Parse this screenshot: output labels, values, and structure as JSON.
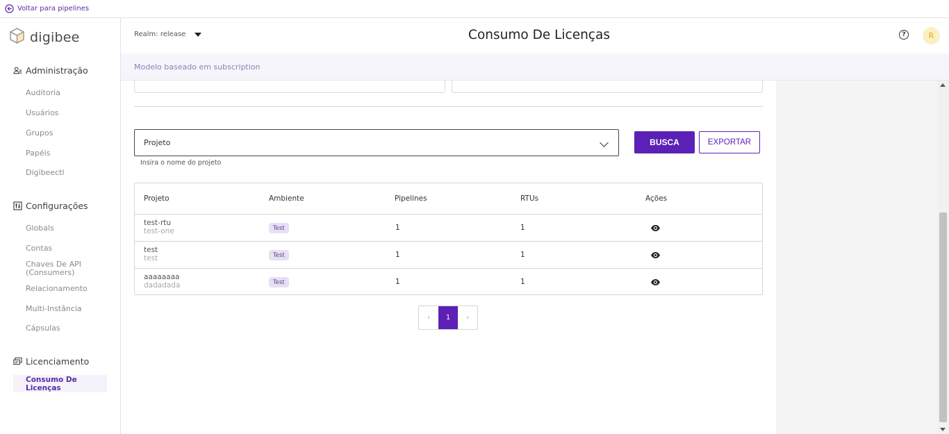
{
  "topbar": {
    "back_label": "Voltar para pipelines"
  },
  "brand": {
    "name": "digibee",
    "accent": "#5b21b6"
  },
  "sidebar": {
    "sections": [
      {
        "title": "Administração",
        "icon": "users-icon",
        "items": [
          "Auditoria",
          "Usuários",
          "Grupos",
          "Papéis",
          "Digibeectl"
        ]
      },
      {
        "title": "Configurações",
        "icon": "settings-sliders-icon",
        "items": [
          "Globals",
          "Contas",
          "Chaves De API (Consumers)",
          "Relacionamento",
          "Multi-Instância",
          "Cápsulas"
        ]
      },
      {
        "title": "Licenciamento",
        "icon": "license-icon",
        "items": [
          "Consumo De Licenças"
        ]
      }
    ],
    "active_item": "Consumo De Licenças"
  },
  "header": {
    "realm": "Realm: release",
    "title": "Consumo De Licenças",
    "help_symbol": "?",
    "avatar_initial": "R"
  },
  "subheader": {
    "text": "Modelo baseado em subscription"
  },
  "filter": {
    "select_value": "Projeto",
    "helper": "Insira o nome do projeto",
    "search_label": "BUSCA",
    "export_label": "EXPORTAR"
  },
  "table": {
    "headers": [
      "Projeto",
      "Ambiente",
      "Pipelines",
      "RTUs",
      "Ações"
    ],
    "rows": [
      {
        "project": "test-rtu",
        "subtitle": "test-one",
        "env": "Test",
        "pipelines": "1",
        "rtus": "1"
      },
      {
        "project": "test",
        "subtitle": "test",
        "env": "Test",
        "pipelines": "1",
        "rtus": "1"
      },
      {
        "project": "aaaaaaaa",
        "subtitle": "dadadada",
        "env": "Test",
        "pipelines": "1",
        "rtus": "1"
      }
    ]
  },
  "pagination": {
    "prev": "‹",
    "current": "1",
    "next": "›"
  }
}
